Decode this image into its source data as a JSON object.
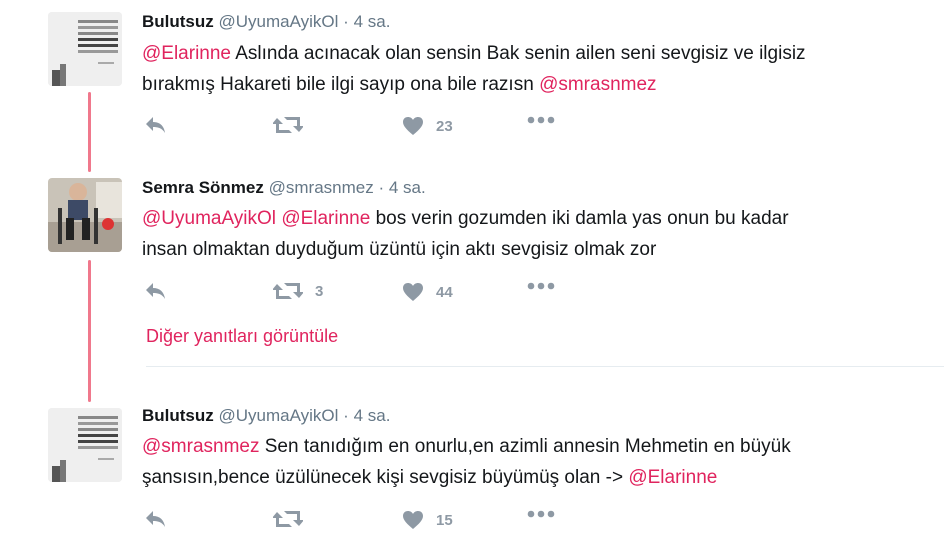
{
  "tweets": [
    {
      "name": "Bulutsuz",
      "handle": "@UyumaAyikOl",
      "time": "4 sa.",
      "line1": [
        {
          "t": "@Elarinne",
          "m": true
        },
        {
          "t": " Aslında acınacak olan sensin Bak senin ailen seni sevgisiz ve ilgisiz",
          "m": false
        }
      ],
      "line2": [
        {
          "t": "bırakmış Hakareti bile ilgi sayıp ona bile razısn ",
          "m": false
        },
        {
          "t": "@smrasnmez",
          "m": true
        }
      ],
      "retweets": "",
      "likes": "23",
      "avatar_text": "Anlamadığı erkeğini kendi gözünden de uzaklaşır ve bir yaşamı. Yalnız Bivaş olmazsa bize yeter, bir yanan sıkı olmayanlar."
    },
    {
      "name": "Semra Sönmez",
      "handle": "@smrasnmez",
      "time": "4 sa.",
      "line1": [
        {
          "t": "@UyumaAyikOl",
          "m": true
        },
        {
          "t": " ",
          "m": false
        },
        {
          "t": "@Elarinne",
          "m": true
        },
        {
          "t": " bos verin gozumden iki damla yas onun bu kadar",
          "m": false
        }
      ],
      "line2": [
        {
          "t": "insan olmaktan duyduğum üzüntü için aktı sevgisiz olmak zor",
          "m": false
        }
      ],
      "retweets": "3",
      "likes": "44"
    },
    {
      "name": "Bulutsuz",
      "handle": "@UyumaAyikOl",
      "time": "4 sa.",
      "line1": [
        {
          "t": "@smrasnmez",
          "m": true
        },
        {
          "t": " Sen tanıdığım en onurlu,en azimli annesin Mehmetin en büyük",
          "m": false
        }
      ],
      "line2": [
        {
          "t": "şansısın,bence üzülünecek kişi sevgisiz büyümüş olan -> ",
          "m": false
        },
        {
          "t": "@Elarinne",
          "m": true
        }
      ],
      "retweets": "",
      "likes": "15",
      "avatar_text": "Anlamadığı erkeğini kendi gözünden de uzaklaşır ve bir yaşamı. Yalnız Bivaş olmazsa bize yeter, bir yanan sıkı olmayanlar."
    }
  ],
  "more_replies": "Diğer yanıtları görüntüle",
  "dot": "·",
  "colors": {
    "accent": "#e0245e",
    "thread": "#f0788c",
    "muted": "#8e99a4"
  }
}
